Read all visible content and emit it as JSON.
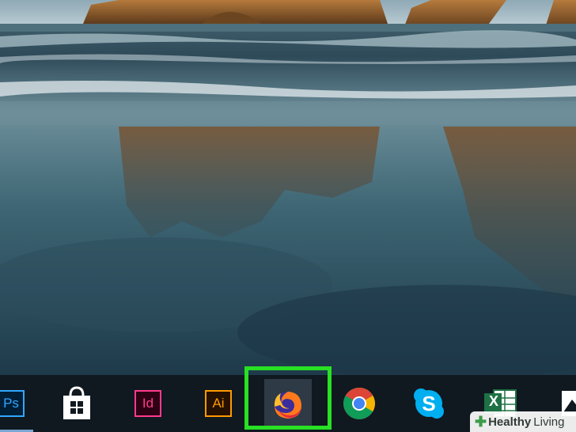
{
  "wallpaper": {
    "name": "beach-with-rock-arches"
  },
  "taskbar": {
    "items": [
      {
        "name": "photoshop",
        "label": "Ps",
        "color": "#31a8ff"
      },
      {
        "name": "store",
        "icon": "shopping-bag-icon",
        "color": "#ffffff"
      },
      {
        "name": "indesign",
        "label": "Id",
        "color": "#ff3b8d"
      },
      {
        "name": "illustrator",
        "label": "Ai",
        "color": "#ff9a00"
      },
      {
        "name": "firefox",
        "icon": "firefox-icon",
        "active": true
      },
      {
        "name": "chrome",
        "icon": "chrome-icon"
      },
      {
        "name": "skype",
        "icon": "skype-icon",
        "color": "#00aff0"
      },
      {
        "name": "excel",
        "label": "X",
        "color": "#1e7145"
      },
      {
        "name": "photos",
        "icon": "picture-icon"
      }
    ],
    "highlight_color": "#28e024"
  },
  "watermark": {
    "brand_a": "Healthy",
    "brand_b": "Living"
  }
}
